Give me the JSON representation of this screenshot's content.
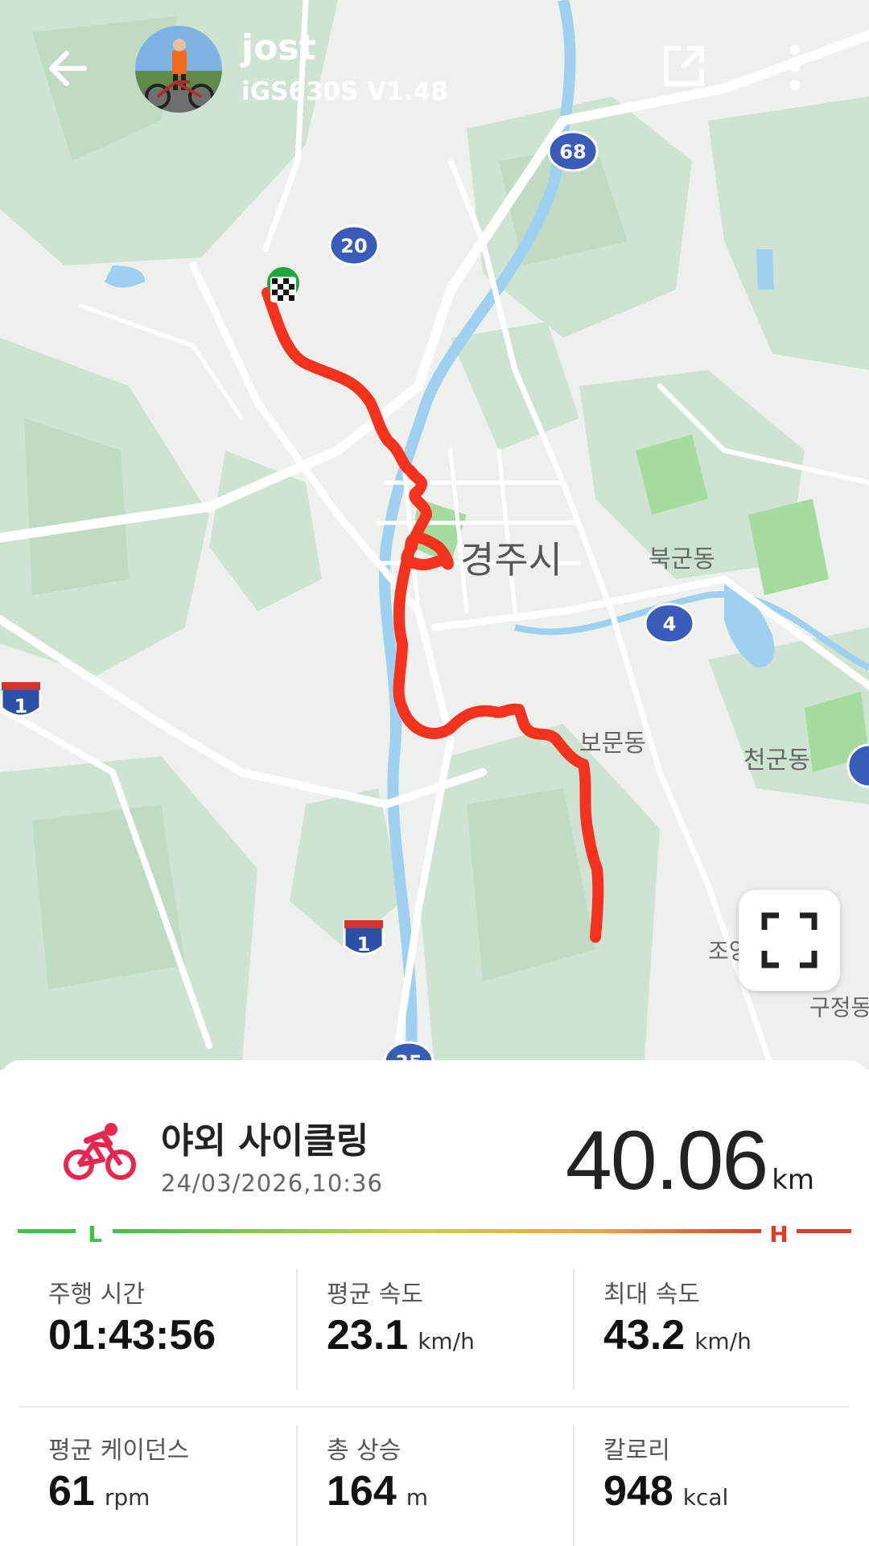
{
  "header": {
    "username": "jost",
    "device": "iGS630S  V1.48"
  },
  "map": {
    "place_labels": [
      "경주시",
      "북군동",
      "보문동",
      "천군동",
      "조양",
      "구정동"
    ],
    "road_markers": [
      "68",
      "20",
      "4",
      "1",
      "1",
      "35"
    ],
    "route_color": "#f4321e",
    "start_marker_color": "#20a63a"
  },
  "summary": {
    "activity_type": "야외 사이클링",
    "datetime": "24/03/2026,10:36",
    "distance_value": "40.06",
    "distance_unit": "km",
    "accent_color": "#e8264f"
  },
  "intensity": {
    "low_label": "L",
    "high_label": "H",
    "low_color": "#3ec24a",
    "high_color": "#e23a24"
  },
  "stats": {
    "moving_time_label": "주행 시간",
    "moving_time_value": "01:43:56",
    "avg_speed_label": "평균 속도",
    "avg_speed_value": "23.1",
    "avg_speed_unit": "km/h",
    "max_speed_label": "최대 속도",
    "max_speed_value": "43.2",
    "max_speed_unit": "km/h",
    "avg_cadence_label": "평균 케이던스",
    "avg_cadence_value": "61",
    "avg_cadence_unit": "rpm",
    "elev_gain_label": "총 상승",
    "elev_gain_value": "164",
    "elev_gain_unit": "m",
    "calories_label": "칼로리",
    "calories_value": "948",
    "calories_unit": "kcal"
  },
  "icons": {
    "back": "arrow-left-icon",
    "share": "share-external-icon",
    "more": "more-vertical-icon",
    "fullscreen": "fullscreen-icon",
    "activity": "cycling-icon"
  }
}
